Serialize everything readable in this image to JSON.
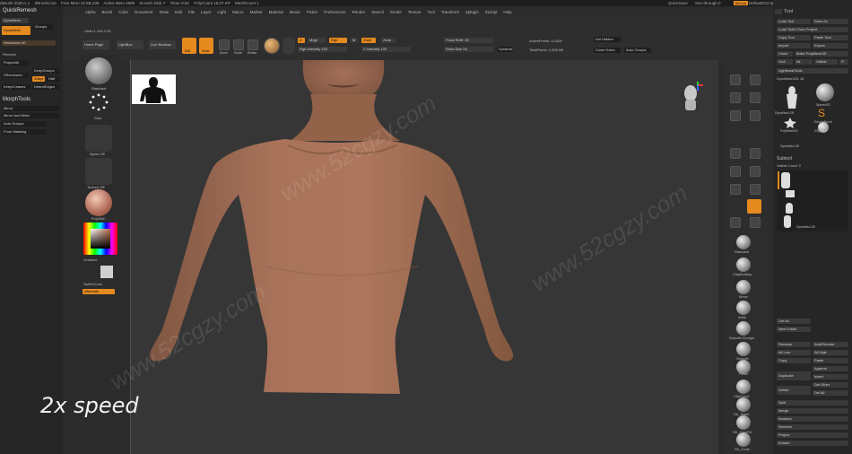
{
  "title_bar": {
    "items": [
      "ZBrush 2020.1.1",
      "ZBrushCore",
      "Free Mem 42.5B,238",
      "Active Mem 4888",
      "Scratch Disk 7",
      "Timer 0.82",
      "PolyCount 15.07 KP",
      "MeshCount 1"
    ],
    "quicksave": "QuickSave",
    "see_through": "See-through 0",
    "menus": "Menus",
    "default_script": "DefaultZScript"
  },
  "menu_bar": {
    "items": [
      "Alpha",
      "Brush",
      "Color",
      "Document",
      "Draw",
      "Edit",
      "File",
      "Layer",
      "Light",
      "Macro",
      "Marker",
      "Material",
      "Movie",
      "Picker",
      "Preferences",
      "Render",
      "Stencil",
      "Stroke",
      "Texture",
      "Tool",
      "Transform",
      "Zplugin",
      "Zscript",
      "Help"
    ]
  },
  "left_panel": {
    "quick_remesh": "QuickRemesh",
    "dynamesh": "DynaMesh",
    "groups": "Groups",
    "resolution": "Resolution 40",
    "remesh": "Remesh",
    "project_all": "ProjectAll",
    "zremesher": "ZRemesher",
    "keep_groups": "KeepGroups",
    "adapt": "Adapt",
    "half": "Half",
    "keep_creases": "KeepCreases",
    "detect_edges": "DetectEdges",
    "morph_tools": "MorphTools",
    "mirror": "Mirror",
    "mirror_and_weld": "Mirror And Weld",
    "auto_groups": "Auto Groups",
    "from_masking": "From Masking"
  },
  "top_shelf": {
    "frame_label": "Undo 1 20k 0.15",
    "home_page": "Home Page",
    "lightbox": "LightBox",
    "live_boolean": "Live Boolean",
    "edit": "Edit",
    "draw": "Draw",
    "move": "Move",
    "scale": "Scale",
    "rotate": "Rotate",
    "a_label": "A",
    "mrgb": "Mrgb",
    "rgb": "Rgb",
    "m_label": "M",
    "zadd": "Zadd",
    "zsub": "Zsub",
    "zcut": "Zcut",
    "rgb_intensity": "Rgb Intensity 100",
    "z_intensity": "Z Intensity 100",
    "focal_shift": "Focal Shift -30",
    "draw_size": "Draw Size 94",
    "dynamic": "Dynamic",
    "active_points": "ActivePoints: 14,828",
    "total_points": "TotalPoints: 2,608 Mil",
    "dot_hidden": "Del Hidden",
    "close_holes": "Close Holes",
    "auto_groups": "Auto Groups"
  },
  "left_shelf": {
    "standard": "Standard",
    "dots": "Dots",
    "alpha_off": "Alpha Off",
    "texture_off": "Texture Off",
    "poly_skin": "PolySkin",
    "gradient": "Gradient",
    "switch_color": "SwitchColor",
    "alternate": "Alternate"
  },
  "right_shelf": {
    "brushes": [
      "Standard",
      "ClayBuildup",
      "Move",
      "Inflat",
      "Smooth Groups",
      "Smooth",
      "Pinch",
      "ClipCurve",
      "SK_Slash",
      "SK_ClayFill",
      "SK_Cloth",
      "SK_ClayFill"
    ]
  },
  "right_panel": {
    "title": "Tool",
    "load_tool": "Load Tool",
    "save_as": "Save As",
    "load_tools_from_project": "Load Tools From Project",
    "copy_tool": "Copy Tool",
    "paste_tool": "Paste Tool",
    "import": "Import",
    "export": "Export",
    "clone": "Clone",
    "make_polymesh": "Make PolyMesh3D",
    "goz": "GoZ",
    "all": "All",
    "visible": "Visible",
    "r": "R",
    "lightbox_tools": "Lightbox▸Tools",
    "dynawax_label": "DynaWax128: 48",
    "subtools": [
      "DynaWax128",
      "Sphere3D",
      "SimpleBrush",
      "PolyMesh3D",
      "ZSphere",
      "DynaWax128"
    ],
    "subtool": "Subtool",
    "visible_count": "Visible Count 2",
    "list_all": "List All",
    "new_folder": "New Folder",
    "rename": "Rename",
    "auto_reorder": "AutoReorder",
    "all_low": "All Low",
    "all_high": "All High",
    "copy": "Copy",
    "paste": "Paste",
    "duplicate": "Duplicate",
    "append": "Append",
    "insert": "Insert",
    "delete": "Delete",
    "del_other": "Del Other",
    "del_all": "Del All",
    "split": "Split",
    "merge": "Merge",
    "boolean": "Boolean",
    "remesh": "Remesh",
    "project": "Project",
    "extract": "Extract"
  },
  "overlay": {
    "speed_label": "2x speed",
    "watermark": "www.52cgzy.com"
  },
  "colors": {
    "accent": "#e58a1f",
    "skin": "#a9735a",
    "background": "#363636"
  }
}
